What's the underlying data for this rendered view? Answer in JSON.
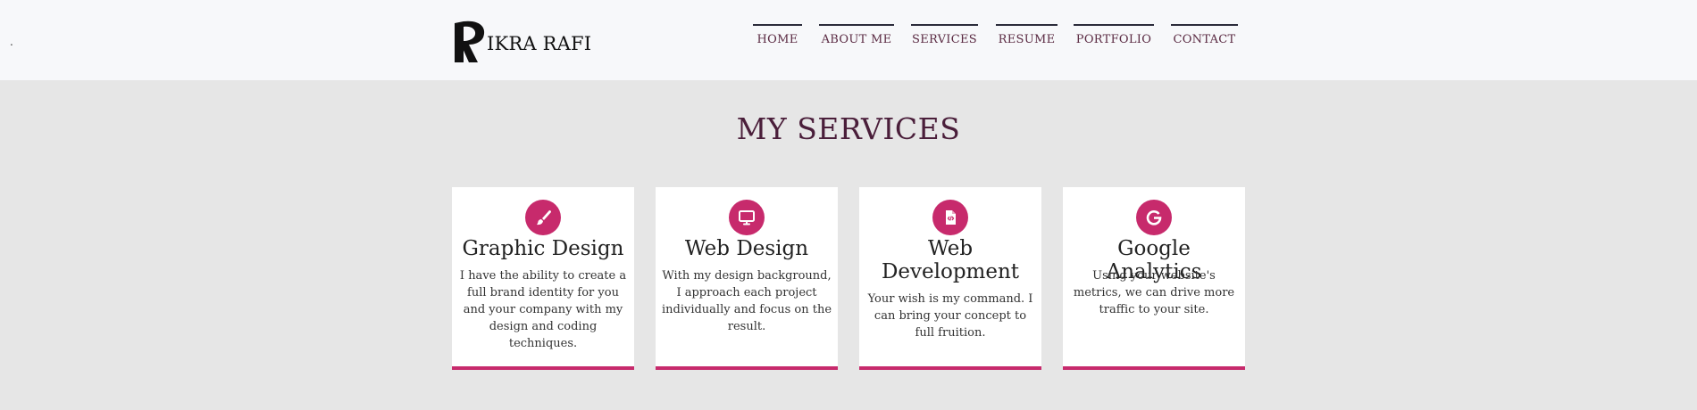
{
  "header": {
    "stray_mark": ".",
    "logo_text": "IKRA RAFI",
    "nav": [
      "HOME",
      "ABOUT ME",
      "SERVICES",
      "RESUME",
      "PORTFOLIO",
      "CONTACT"
    ]
  },
  "services": {
    "title": "MY SERVICES",
    "cards": [
      {
        "icon": "paintbrush-icon",
        "title": "Graphic Design",
        "desc": "I have the ability to create a full brand identity for you and your company with my design and coding techniques."
      },
      {
        "icon": "monitor-icon",
        "title": "Web Design",
        "desc": "With my design background, I approach each project individually and focus on the result."
      },
      {
        "icon": "code-file-icon",
        "title": "Web Development",
        "desc": "Your wish is my command. I can bring your concept to full fruition."
      },
      {
        "icon": "google-icon",
        "title": "Google Analytics",
        "desc": "Using your website's metrics, we can drive more traffic to your site."
      }
    ]
  },
  "colors": {
    "accent": "#c72a6c",
    "title": "#4a1e3a",
    "nav_text": "#5a2a42",
    "background": "#e6e6e6",
    "header_bg": "#f7f8fa"
  }
}
